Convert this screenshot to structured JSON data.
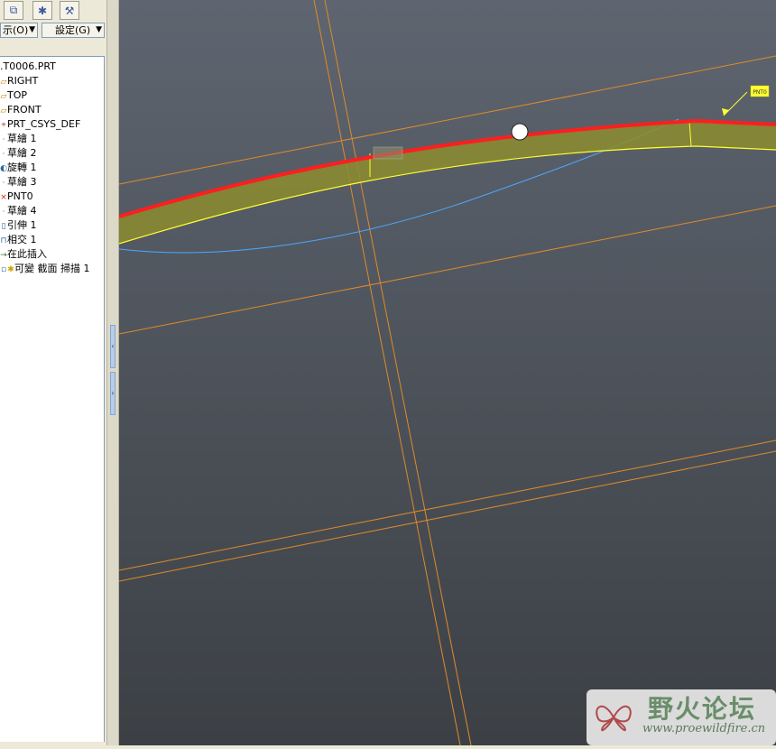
{
  "toolbar": {
    "buttons": [
      {
        "icon": "copy-layers-icon"
      },
      {
        "icon": "star-feature-icon"
      },
      {
        "icon": "settings-tool-icon"
      }
    ]
  },
  "dropdowns": {
    "show_label": "示(O)",
    "settings_label": "設定(G)"
  },
  "model_tree": {
    "items": [
      {
        "label": ".T0006.PRT",
        "icon": "part-icon"
      },
      {
        "label": "RIGHT",
        "icon": "datum-plane-icon"
      },
      {
        "label": "TOP",
        "icon": "datum-plane-icon"
      },
      {
        "label": "FRONT",
        "icon": "datum-plane-icon"
      },
      {
        "label": "PRT_CSYS_DEF",
        "icon": "csys-icon"
      },
      {
        "label": "草繪 1",
        "icon": "sketch-icon"
      },
      {
        "label": "草繪 2",
        "icon": "sketch-icon"
      },
      {
        "label": "旋轉 1",
        "icon": "revolve-icon"
      },
      {
        "label": "草繪 3",
        "icon": "sketch-icon"
      },
      {
        "label": "PNT0",
        "icon": "datum-point-icon"
      },
      {
        "label": "草繪 4",
        "icon": "sketch-icon"
      },
      {
        "label": "引伸 1",
        "icon": "extrude-icon"
      },
      {
        "label": "相交 1",
        "icon": "intersect-icon"
      },
      {
        "label": "在此插入",
        "icon": "insert-here-icon"
      },
      {
        "label": "可變 截面 掃描 1",
        "icon": "star-feature-icon"
      }
    ]
  },
  "viewport": {
    "point_label": "PNT0",
    "colors": {
      "background_top": "#5e6570",
      "background_bottom": "#3c4045",
      "trajectory": "#ff1e1e",
      "surface_fill": "#8c8c2e",
      "edge_yellow": "#ffff33",
      "datum_orange": "#e08a2a",
      "curve_blue": "#4aa8ff"
    }
  },
  "watermark": {
    "title": "野火论坛",
    "url": "www.proewildfire.cn"
  }
}
